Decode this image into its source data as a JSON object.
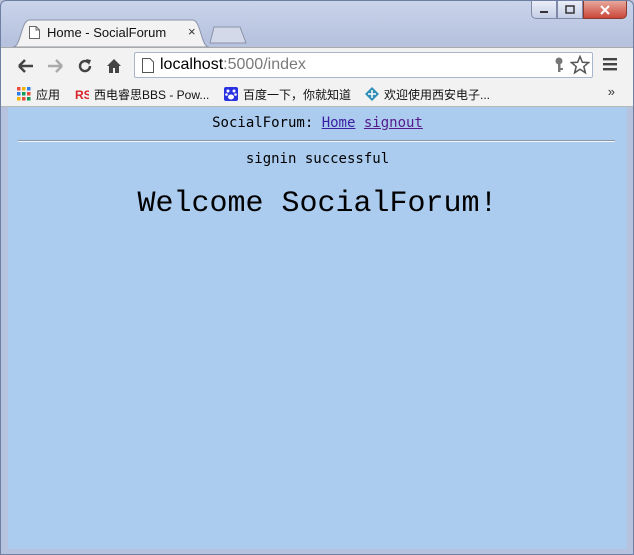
{
  "browser": {
    "tab_title": "Home - SocialForum",
    "tab_close": "×",
    "url_host": "localhost",
    "url_rest": ":5000/index",
    "bookmarks": [
      {
        "label": "应用",
        "icon": "apps-grid-icon"
      },
      {
        "label": "西电睿思BBS - Pow...",
        "icon": "rs-logo-icon"
      },
      {
        "label": "百度一下，你就知道",
        "icon": "baidu-paw-icon"
      },
      {
        "label": "欢迎使用西安电子...",
        "icon": "xidian-logo-icon"
      }
    ],
    "bookmarks_more": "»"
  },
  "page": {
    "brand": "SocialForum:",
    "nav_home": "Home",
    "nav_signout": "signout",
    "flash": "signin successful",
    "heading": "Welcome SocialForum!"
  },
  "colors": {
    "page_bg": "#abccef",
    "link": "#3b1fa3"
  }
}
